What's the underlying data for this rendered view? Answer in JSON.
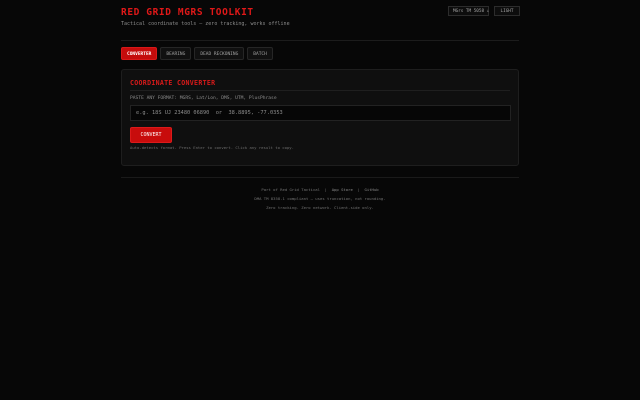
{
  "header": {
    "title": "RED GRID MGRS TOOLKIT",
    "subtitle": "Tactical coordinate tools — zero tracking, works offline",
    "mgrs_button": "MGrs TM 5058 ↓",
    "light_button": "LIGHT"
  },
  "tabs": [
    {
      "label": "CONVERTER",
      "active": true
    },
    {
      "label": "BEARING",
      "active": false
    },
    {
      "label": "DEAD RECKONING",
      "active": false
    },
    {
      "label": "BATCH",
      "active": false
    }
  ],
  "converter": {
    "title": "COORDINATE CONVERTER",
    "input_label": "PASTE ANY FORMAT: MGRS, Lat/Lon, DMS, UTM, PlusPhrase",
    "input_placeholder": "e.g. 18S UJ 23480 06890  or  38.8895, -77.0353",
    "button_label": "CONVERT",
    "hint": "Auto-detects format. Press Enter to convert. Click any result to copy."
  },
  "footer": {
    "part_of": "Part of Red Grid Tactical",
    "separator": "|",
    "app_store": "App Store",
    "github": "GitHub",
    "compliance": "DMA TM 8358.1 compliant — uses truncation, not rounding.",
    "privacy": "Zero tracking. Zero network. Client-side only."
  },
  "colors": {
    "accent": "#c40c0c",
    "title_red": "#e01818",
    "background": "#070707",
    "card": "#0f0f0f"
  }
}
